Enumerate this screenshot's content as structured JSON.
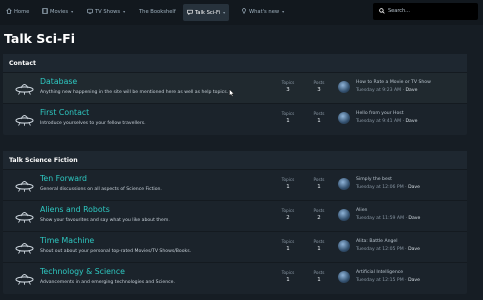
{
  "nav": {
    "items": [
      {
        "label": "Home",
        "icon": "home-icon"
      },
      {
        "label": "Movies",
        "icon": "film-icon"
      },
      {
        "label": "TV Shows",
        "icon": "tv-icon"
      },
      {
        "label": "The Bookshelf",
        "icon": ""
      },
      {
        "label": "Talk Sci-Fi",
        "icon": "chat-icon"
      },
      {
        "label": "What's new",
        "icon": "pin-icon"
      }
    ],
    "active_index": 4
  },
  "search": {
    "placeholder": "Search..."
  },
  "page": {
    "title": "Talk Sci-Fi"
  },
  "colors": {
    "accent": "#2ec9c2",
    "background": "#161d24",
    "nav": "#12181e"
  },
  "stats_labels": {
    "topics": "Topics",
    "posts": "Posts"
  },
  "sections": [
    {
      "title": "Contact",
      "forums": [
        {
          "name": "Database",
          "desc": "Anything new happening in the site will be mentioned here as well as help topics.",
          "topics": "3",
          "posts": "3",
          "last_title": "How to Rate a Movie or TV Show",
          "last_time": "Tuesday at 9:23 AM",
          "last_user": "Dave"
        },
        {
          "name": "First Contact",
          "desc": "Introduce yourselves to your fellow travellers.",
          "topics": "1",
          "posts": "1",
          "last_title": "Hello from your Host",
          "last_time": "Tuesday at 9:41 AM",
          "last_user": "Dave"
        }
      ]
    },
    {
      "title": "Talk Science Fiction",
      "forums": [
        {
          "name": "Ten Forward",
          "desc": "General discussions on all aspects of Science Fiction.",
          "topics": "1",
          "posts": "1",
          "last_title": "Simply the best",
          "last_time": "Tuesday at 12:06 PM",
          "last_user": "Dave"
        },
        {
          "name": "Aliens and Robots",
          "desc": "Show your favourites and say what you like about them.",
          "topics": "2",
          "posts": "2",
          "last_title": "Alien",
          "last_time": "Tuesday at 11:59 AM",
          "last_user": "Dave"
        },
        {
          "name": "Time Machine",
          "desc": "Shout out about your personal top-rated Movies/TV Shows/Books.",
          "topics": "1",
          "posts": "1",
          "last_title": "Alita: Battle Angel",
          "last_time": "Tuesday at 12:05 PM",
          "last_user": "Dave"
        },
        {
          "name": "Technology & Science",
          "desc": "Advancements in and emerging technologies and Science.",
          "topics": "1",
          "posts": "1",
          "last_title": "Artificial Intelligence",
          "last_time": "Tuesday at 12:15 PM",
          "last_user": "Dave"
        }
      ]
    }
  ]
}
